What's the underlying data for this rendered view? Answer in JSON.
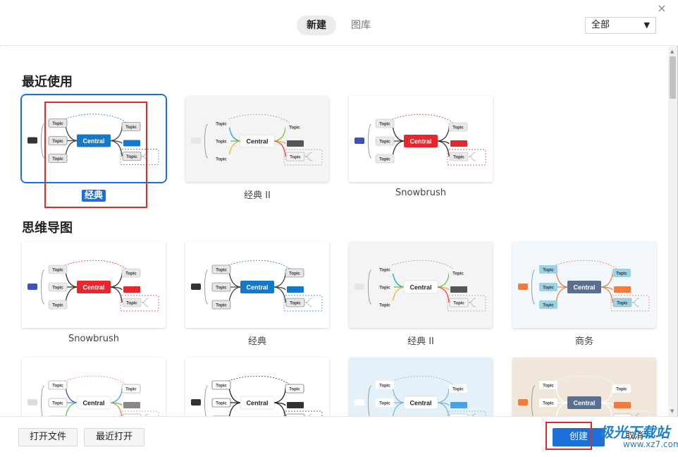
{
  "header": {
    "tabs": [
      {
        "label": "新建",
        "active": true
      },
      {
        "label": "图库",
        "active": false
      }
    ],
    "filter": {
      "value": "全部"
    },
    "close_glyph": "×"
  },
  "sections": [
    {
      "title": "最近使用",
      "templates": [
        {
          "name": "经典",
          "style": "classic",
          "selected": true
        },
        {
          "name": "经典 II",
          "style": "classic2",
          "selected": false
        },
        {
          "name": "Snowbrush",
          "style": "snowbrush",
          "selected": false
        }
      ]
    },
    {
      "title": "思维导图",
      "templates": [
        {
          "name": "Snowbrush",
          "style": "snowbrush"
        },
        {
          "name": "经典",
          "style": "classic"
        },
        {
          "name": "经典 II",
          "style": "classic2"
        },
        {
          "name": "商务",
          "style": "business"
        },
        {
          "name": "",
          "style": "colorful"
        },
        {
          "name": "",
          "style": "dark"
        },
        {
          "name": "",
          "style": "blueish"
        },
        {
          "name": "",
          "style": "warm"
        }
      ]
    }
  ],
  "node_text": {
    "central": "Central",
    "topic": "Topic",
    "subtopic": "Topic"
  },
  "footer": {
    "open_file": "打开文件",
    "recent_open": "最近打开",
    "create": "创建",
    "cancel": "取消"
  },
  "watermark": {
    "line1": "极光下载站",
    "line2": "www.xz7.com"
  },
  "colors": {
    "accent": "#1a6fd8",
    "highlight_red": "#e32a2a",
    "snowbrush_red": "#e8262e",
    "classic_blue": "#1479c8",
    "business_slate": "#5a6f8f"
  }
}
